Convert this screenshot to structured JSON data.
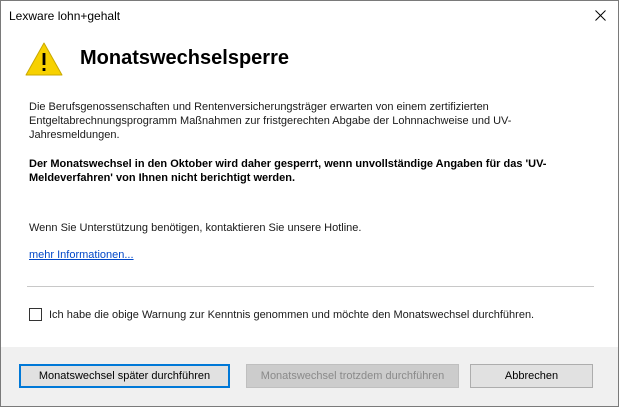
{
  "window": {
    "title": "Lexware lohn+gehalt",
    "close_icon": "close-icon"
  },
  "dialog": {
    "icon": "warning-icon",
    "heading": "Monatswechselsperre",
    "paragraph1": "Die Berufsgenossenschaften und Rentenversicherungsträger erwarten von einem zertifizierten Entgeltabrechnungsprogramm Maßnahmen zur fristgerechten Abgabe der Lohnnachweise und UV-Jahresmeldungen.",
    "paragraph2": "Der Monatswechsel in den Oktober wird daher gesperrt, wenn unvollständige Angaben für das 'UV-Meldeverfahren' von Ihnen nicht berichtigt werden.",
    "support_text": "Wenn Sie Unterstützung benötigen, kontaktieren Sie unsere Hotline.",
    "more_info_link": "mehr Informationen...",
    "checkbox": {
      "label": "Ich habe die obige Warnung zur Kenntnis genommen und möchte den Monatswechsel durchführen.",
      "checked": false
    }
  },
  "buttons": {
    "later": "Monatswechsel später durchführen",
    "anyway": "Monatswechsel trotzdem durchführen",
    "cancel": "Abbrechen"
  },
  "colors": {
    "warning_yellow": "#f7d100",
    "link": "#0047c8",
    "focus_border": "#0078d7"
  }
}
